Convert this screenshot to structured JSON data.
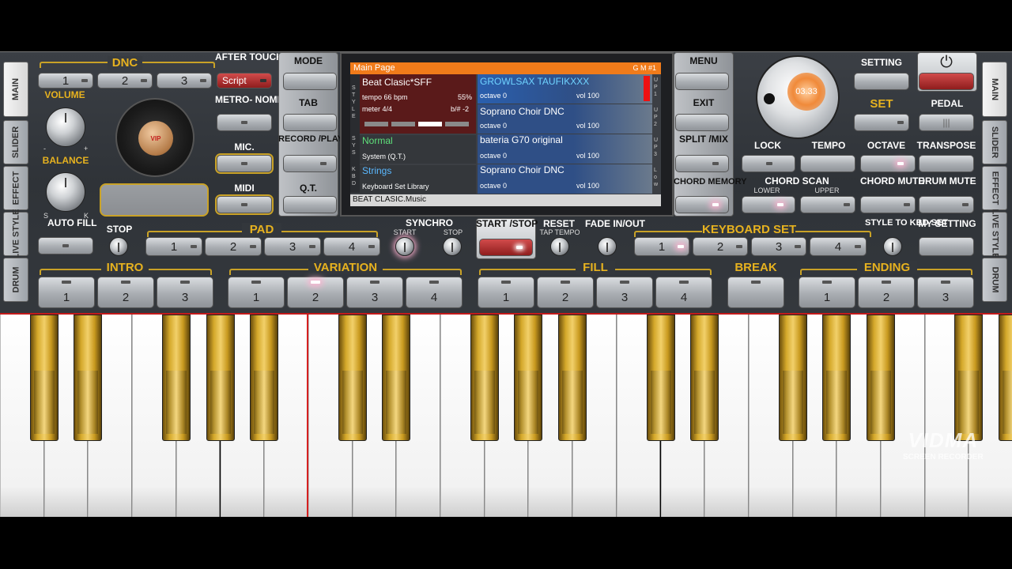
{
  "sidebar_left": [
    "MAIN",
    "SLIDER",
    "EFFECT",
    "LIVE STYLE",
    "DRUM"
  ],
  "sidebar_right": [
    "MAIN",
    "SLIDER",
    "EFFECT",
    "LIVE STYLE",
    "DRUM"
  ],
  "dnc": {
    "label": "DNC",
    "buttons": [
      "1",
      "2",
      "3"
    ],
    "script": "Script"
  },
  "after_touch": "AFTER TOUCH",
  "metronome": "METRO- NOME",
  "mic": "MIC.",
  "midi": "MIDI",
  "volume": "VOLUME",
  "balance": "BALANCE",
  "balance_marks": {
    "minus": "-",
    "plus": "+",
    "s": "S",
    "k": "K"
  },
  "auto_fill": "AUTO FILL",
  "jog_label": "VIP",
  "mode": "MODE",
  "tab": "TAB",
  "record_play": "RECORD /PLAY",
  "qt": "Q.T.",
  "menu": "MENU",
  "exit": "EXIT",
  "split_mix": "SPLIT /MIX",
  "chord_memory": "CHORD MEMORY",
  "setting": "SETTING",
  "set": "SET",
  "pedal": "PEDAL",
  "dial_value": "03.33",
  "lock": "LOCK",
  "tempo": "TEMPO",
  "octave": "OCTAVE",
  "transpose": "TRANSPOSE",
  "chord_scan": "CHORD SCAN",
  "lower": "LOWER",
  "upper": "UPPER",
  "chord_mute": "CHORD MUTE",
  "drum_mute": "DRUM MUTE",
  "screen": {
    "title": "Main Page",
    "gm": "G M #1",
    "style_name": "Beat Clasic*SFF",
    "tempo": "tempo 66 bpm",
    "percent": "55%",
    "meter": "meter 4/4",
    "bsharp": "b/# -2",
    "side_left_top": "S T Y L E",
    "side_left_mid": "S Y S",
    "side_left_bot": "K B D",
    "sys_name": "Normal",
    "sys_sub": "System (Q.T.)",
    "kbd_name": "Strings",
    "kbd_sub": "Keyboard Set Library",
    "footer": "BEAT CLASIC.Music",
    "up1": {
      "name": "GROWLSAX TAUFIKXXX",
      "octave": "octave  0",
      "vol": "vol 100",
      "tag": "U P 1"
    },
    "up2": {
      "name": "Soprano Choir DNC",
      "octave": "octave  0",
      "vol": "vol 100",
      "tag": "U P 2"
    },
    "up3": {
      "name": "bateria G70 original",
      "octave": "octave  0",
      "vol": "vol 100",
      "tag": "U P 3"
    },
    "low": {
      "name": "Soprano Choir DNC",
      "octave": "octave  0",
      "vol": "vol 100",
      "tag": "L o w"
    }
  },
  "stop": "STOP",
  "pad": {
    "label": "PAD",
    "buttons": [
      "1",
      "2",
      "3",
      "4"
    ]
  },
  "synchro": {
    "label": "SYNCHRO",
    "start": "START",
    "stop": "STOP"
  },
  "start_stop": "START /STOP",
  "reset": "RESET",
  "tap_tempo": "TAP TEMPO",
  "fade": "FADE IN/OUT",
  "keyboard_set": {
    "label": "KEYBOARD SET",
    "buttons": [
      "1",
      "2",
      "3",
      "4"
    ]
  },
  "style_to_kbd": "STYLE TO KBD SET",
  "my_setting": "MY SETTING",
  "intro": {
    "label": "INTRO",
    "buttons": [
      "1",
      "2",
      "3"
    ]
  },
  "variation": {
    "label": "VARIATION",
    "buttons": [
      "1",
      "2",
      "3",
      "4"
    ],
    "active": 2
  },
  "fill": {
    "label": "FILL",
    "buttons": [
      "1",
      "2",
      "3",
      "4"
    ]
  },
  "break": "BREAK",
  "ending": {
    "label": "ENDING",
    "buttons": [
      "1",
      "2",
      "3"
    ]
  },
  "watermark": {
    "brand": "VIDMA",
    "sub": "SCREEN RECORDER"
  },
  "colors": {
    "gold": "#e7b21f",
    "accent_orange": "#f07b1a",
    "screen_blue": "#2f4f86",
    "screen_red": "#5a1a1a"
  }
}
